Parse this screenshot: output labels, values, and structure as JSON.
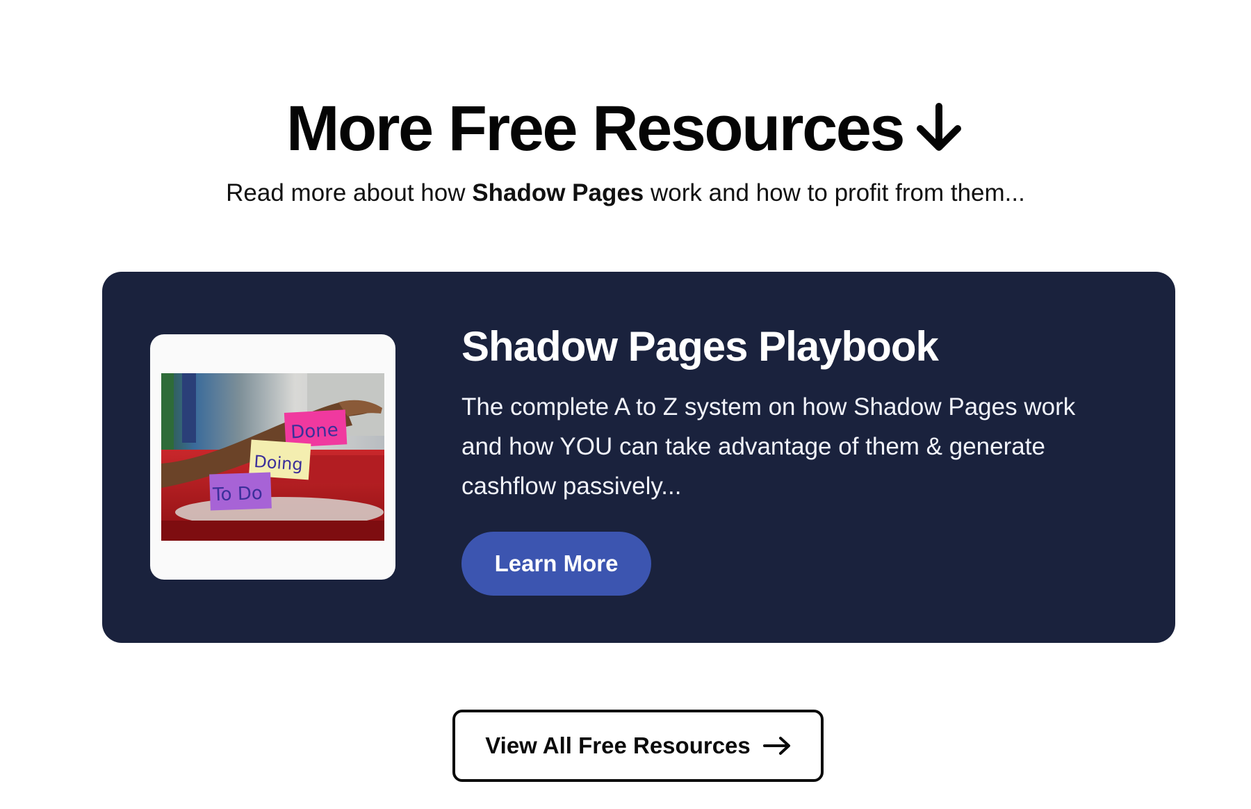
{
  "header": {
    "title": "More Free Resources",
    "subtitle_before": "Read more about how ",
    "subtitle_bold": "Shadow Pages",
    "subtitle_after": " work and how to profit from them...",
    "title_icon": "arrow-down-icon"
  },
  "card": {
    "title": "Shadow Pages Playbook",
    "description": "The complete A to Z system on how Shadow Pages work and how YOU can take advantage of them & generate cashflow passively...",
    "button_label": "Learn More",
    "image": {
      "notes": [
        "Done",
        "Doing",
        "To Do"
      ],
      "note_colors": [
        "#f0399f",
        "#f5eeae",
        "#a763d6"
      ]
    },
    "background_color": "#1a223d",
    "button_color": "#3c55b0"
  },
  "footer": {
    "view_all_label": "View All Free Resources",
    "view_all_icon": "arrow-right-icon"
  }
}
